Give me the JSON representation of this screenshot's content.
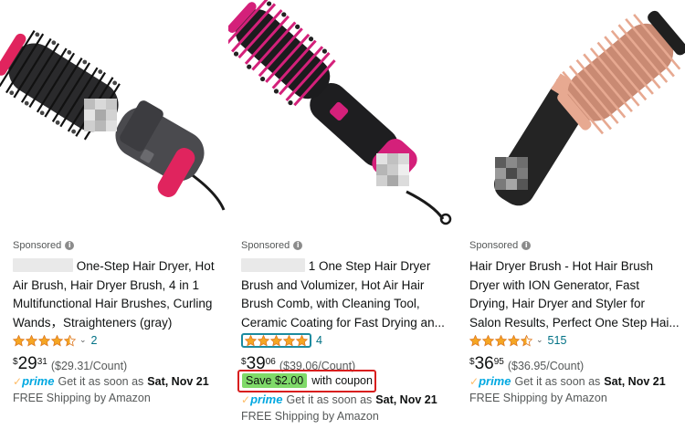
{
  "products": [
    {
      "sponsored_label": "Sponsored",
      "title_lines": [
        "One-Step Hair Dryer, Hot",
        "Air Brush, Hair Dryer Brush, 4 in 1",
        "Multifunctional Hair Brushes, Curling",
        "Wands，Straighteners (gray)"
      ],
      "rating_stars": 4.5,
      "review_count": "2",
      "price_symbol": "$",
      "price_whole": "29",
      "price_fraction": "31",
      "unit_price": "($29.31/Count)",
      "prime_label": "prime",
      "delivery_text": "Get it as soon as",
      "delivery_date": "Sat, Nov 21",
      "shipping_text": "FREE Shipping by Amazon",
      "image_colors": {
        "accent": "#e0245e",
        "body": "#4a4a4e"
      }
    },
    {
      "sponsored_label": "Sponsored",
      "title_lines": [
        "1 One Step Hair Dryer",
        "Brush and Volumizer, Hot Air Hair",
        "Brush Comb, with Cleaning Tool,",
        "Ceramic Coating for Fast Drying an..."
      ],
      "rating_stars": 5,
      "review_count": "4",
      "price_symbol": "$",
      "price_whole": "39",
      "price_fraction": "06",
      "unit_price": "($39.06/Count)",
      "coupon_save": "Save $2.00",
      "coupon_text": "with coupon",
      "prime_label": "prime",
      "delivery_text": "Get it as soon as",
      "delivery_date": "Sat, Nov 21",
      "shipping_text": "FREE Shipping by Amazon",
      "image_colors": {
        "accent": "#d4207a",
        "body": "#1e1e20"
      }
    },
    {
      "sponsored_label": "Sponsored",
      "title_lines": [
        "Hair Dryer Brush - Hot Hair Brush",
        "Dryer with ION Generator, Fast",
        "Drying, Hair Dryer and Styler for",
        "Salon Results, Perfect One Step Hai..."
      ],
      "rating_stars": 4.5,
      "review_count": "515",
      "price_symbol": "$",
      "price_whole": "36",
      "price_fraction": "95",
      "unit_price": "($36.95/Count)",
      "prime_label": "prime",
      "delivery_text": "Get it as soon as",
      "delivery_date": "Sat, Nov 21",
      "shipping_text": "FREE Shipping by Amazon",
      "image_colors": {
        "accent": "#e7a991",
        "body": "#242424"
      }
    }
  ],
  "colors": {
    "star": "#f5a623",
    "link": "#007185",
    "prime": "#00a8e1",
    "coupon_bg": "#7fda69",
    "highlight_border": "#d81e1e"
  }
}
